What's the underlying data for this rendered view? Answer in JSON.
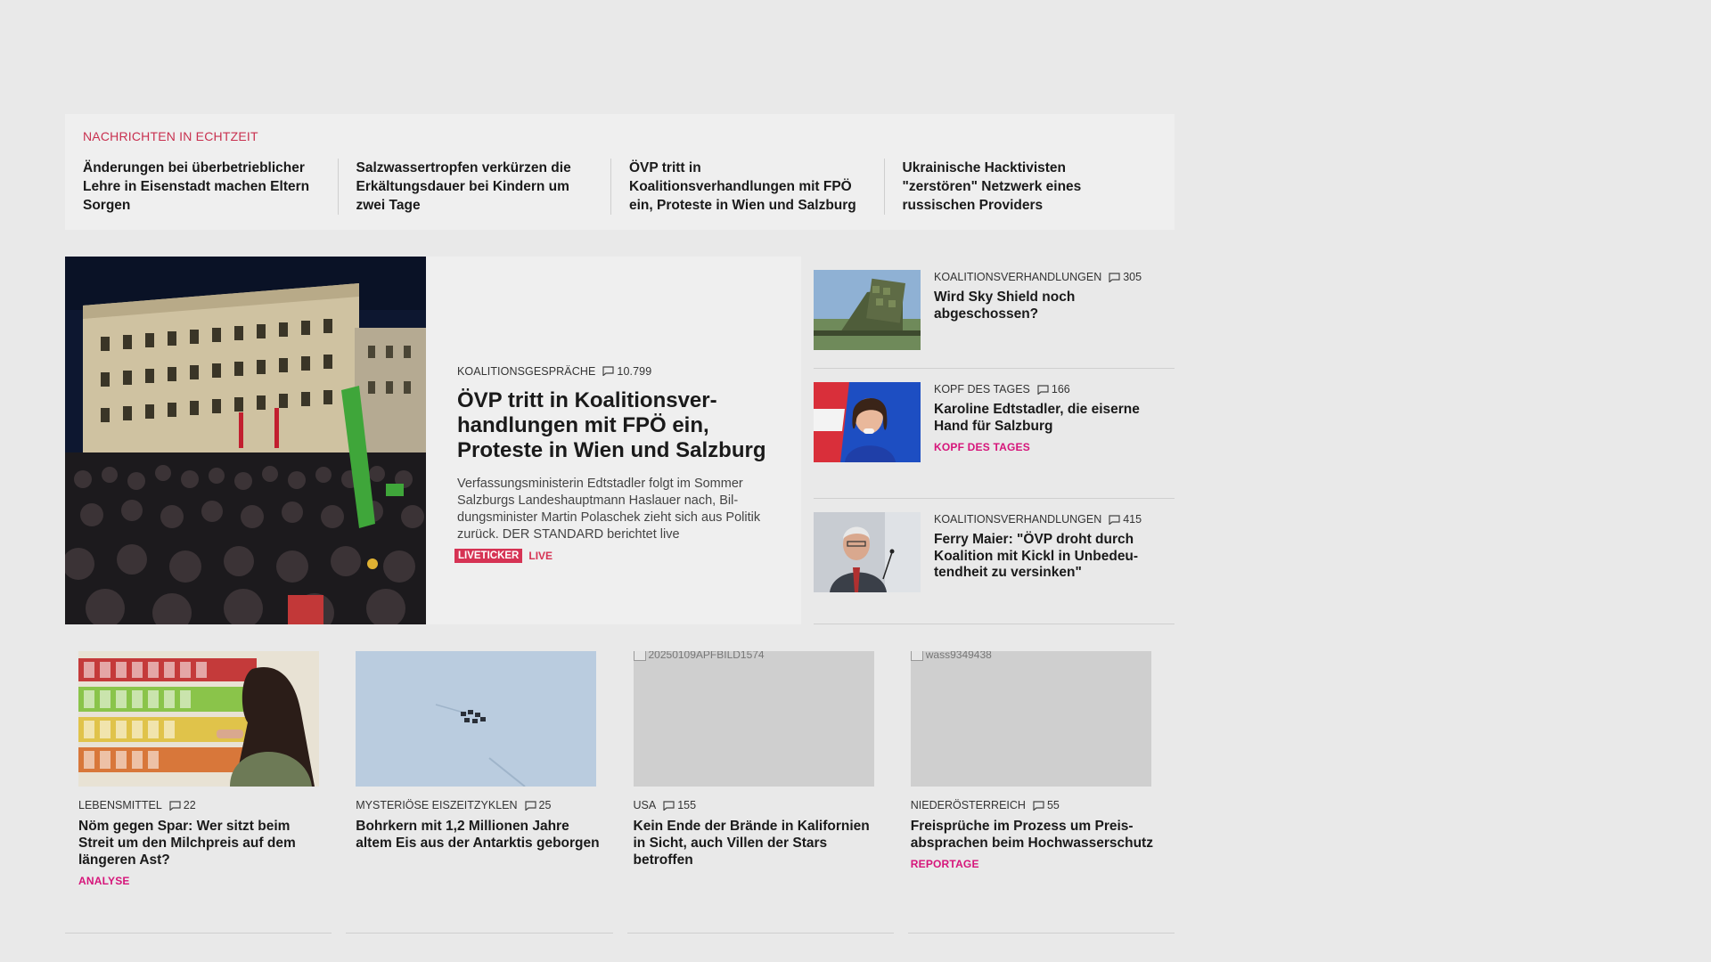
{
  "ticker": {
    "label": "NACHRICHTEN IN ECHTZEIT",
    "items": [
      "Änderungen bei überbetrieblicher Lehre in Eisenstadt machen Eltern Sorgen",
      "Salzwassertropfen verkürzen die Er­kältungsdauer bei Kindern um zwei Tage",
      "ÖVP tritt in Koalitionsverhandlungen mit FPÖ ein, Proteste in Wien und Salzburg",
      "Ukrainische Hacktivisten \"zerstören\" Netzwerk eines russischen Providers"
    ]
  },
  "lead": {
    "kicker": "KOALITIONSGESPRÄCHE",
    "comments": "10.799",
    "title": "ÖVP tritt in Koalitionsver­handlungen mit FPÖ ein, Proteste in Wien und Salzburg",
    "teaser": "Verfassungsministerin Edtstadler folgt im Sommer Salzburgs Landeshauptmann Haslauer nach, Bil­dungsminister Martin Polaschek zieht sich aus Politik zurück. DER STANDARD berichtet live",
    "tag_live": "LIVETICKER",
    "tag_live_text": "LIVE"
  },
  "side": [
    {
      "kicker": "KOALITIONSVERHANDLUNGEN",
      "comments": "305",
      "title": "Wird Sky Shield noch abgeschossen?",
      "rubric": ""
    },
    {
      "kicker": "KOPF DES TAGES",
      "comments": "166",
      "title": "Karoline Edtstadler, die eiserne Hand für Salzburg",
      "rubric": "KOPF DES TAGES"
    },
    {
      "kicker": "KOALITIONSVERHANDLUNGEN",
      "comments": "415",
      "title": "Ferry Maier: \"ÖVP droht durch Koalition mit Kickl in Unbedeu­tendheit zu versinken\"",
      "rubric": ""
    }
  ],
  "cards": [
    {
      "kicker": "LEBENSMITTEL",
      "comments": "22",
      "title": "Nöm gegen Spar: Wer sitzt beim Streit um den Milchpreis auf dem längeren Ast?",
      "rubric": "ANALYSE",
      "alt": ""
    },
    {
      "kicker": "MYSTERIÖSE EISZEITZYKLEN",
      "comments": "25",
      "title": "Bohrkern mit 1,2 Millionen Jahre altem Eis aus der Antarktis geborgen",
      "rubric": "",
      "alt": ""
    },
    {
      "kicker": "USA",
      "comments": "155",
      "title": "Kein Ende der Brände in Kalifornien in Sicht, auch Villen der Stars betroffen",
      "rubric": "",
      "alt": "20250109APFBILD1574"
    },
    {
      "kicker": "NIEDERÖSTERREICH",
      "comments": "55",
      "title": "Freisprüche im Prozess um Preis­absprachen beim Hochwasser­schutz",
      "rubric": "REPORTAGE",
      "alt": "wass9349438"
    }
  ],
  "colors": {
    "accent_red": "#d63354",
    "accent_magenta": "#d6157a",
    "background": "#e9e9e9"
  }
}
